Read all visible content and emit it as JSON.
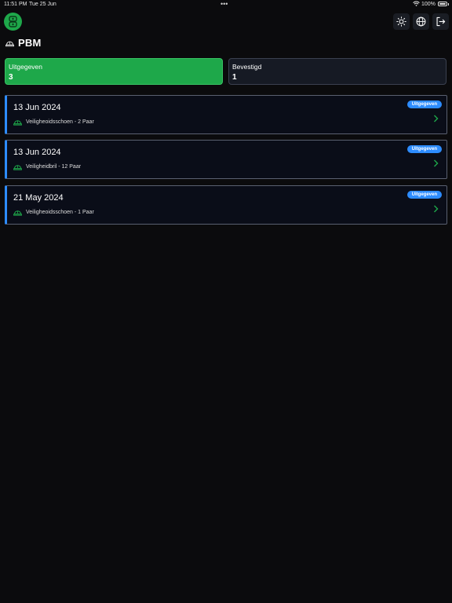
{
  "status_bar": {
    "time": "11:51 PM",
    "date": "Tue 25 Jun",
    "dots": "•••",
    "battery": "100%"
  },
  "header": {
    "title": "PBM",
    "actions": [
      "sun-icon",
      "globe-icon",
      "logout-icon"
    ]
  },
  "stats": [
    {
      "label": "Uitgegeven",
      "value": "3",
      "active": true
    },
    {
      "label": "Bevestigd",
      "value": "1",
      "active": false
    }
  ],
  "issues": [
    {
      "date": "13 Jun 2024",
      "item": "Veiligheoidsschoen - 2 Paar",
      "status": "Uitgegeven"
    },
    {
      "date": "13 Jun 2024",
      "item": "Veiligheidbril - 12 Paar",
      "status": "Uitgegeven"
    },
    {
      "date": "21 May 2024",
      "item": "Veiligheoidsschoen - 1 Paar",
      "status": "Uitgegeven"
    }
  ],
  "colors": {
    "accent_green": "#1ea84a",
    "badge_blue": "#2d8cff",
    "background": "#0b0b0d"
  }
}
